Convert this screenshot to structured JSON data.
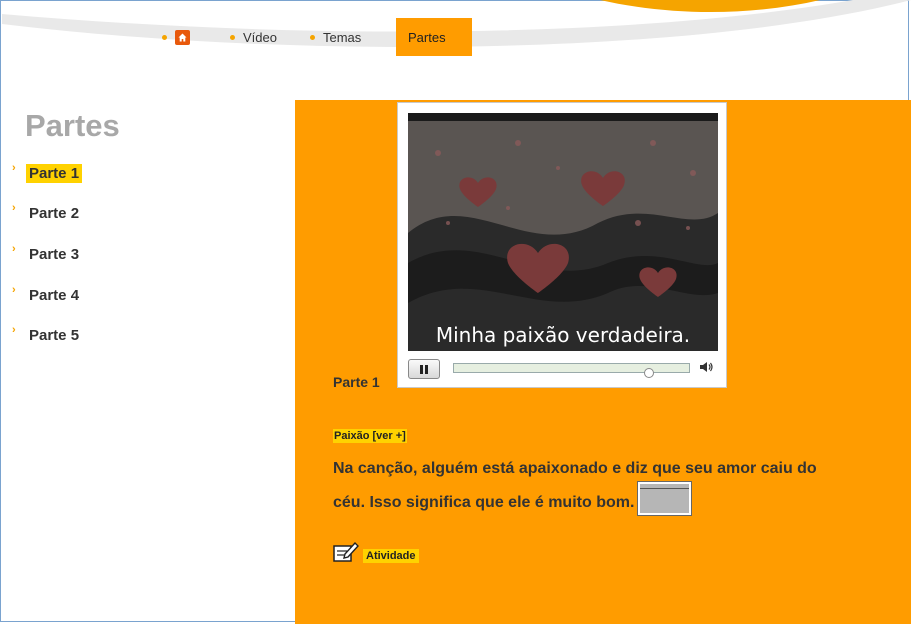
{
  "nav": {
    "items": [
      {
        "label": "Vídeo"
      },
      {
        "label": "Temas"
      },
      {
        "label": "Partes"
      }
    ]
  },
  "sidebar": {
    "title": "Partes",
    "items": [
      {
        "label": "Parte 1",
        "active": true
      },
      {
        "label": "Parte 2"
      },
      {
        "label": "Parte 3"
      },
      {
        "label": "Parte 4"
      },
      {
        "label": "Parte 5"
      }
    ]
  },
  "video": {
    "subtitle": "Minha paixão verdadeira.",
    "progress": 0.81
  },
  "content": {
    "part_heading": "Parte 1",
    "term_link": "Paixão [ver +]",
    "line1": "Na canção, alguém está apaixonado e diz que seu amor caiu do",
    "line2": "céu. Isso significa que ele é muito bom.",
    "activity_label": "Atividade"
  },
  "colors": {
    "accent": "#ff9c00",
    "highlight": "#ffd200",
    "bullet": "#f5a400"
  },
  "icons": [
    "home-icon",
    "pause-icon",
    "volume-icon",
    "activity-icon",
    "chevron-right-icon"
  ]
}
